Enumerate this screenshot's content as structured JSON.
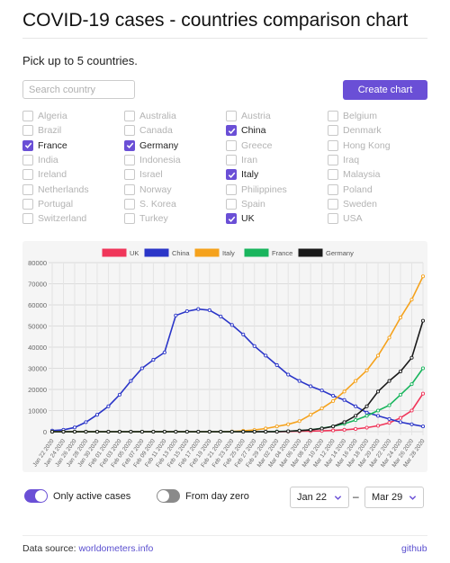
{
  "page": {
    "title": "COVID-19 cases - countries comparison chart",
    "subtitle": "Pick up to 5 countries."
  },
  "search": {
    "placeholder": "Search country",
    "value": ""
  },
  "create_button": {
    "label": "Create chart"
  },
  "accent_color": "#6a4fd6",
  "countries": [
    [
      "Algeria",
      "Brazil",
      "France",
      "India",
      "Ireland",
      "Netherlands",
      "Portugal",
      "Switzerland"
    ],
    [
      "Australia",
      "Canada",
      "Germany",
      "Indonesia",
      "Israel",
      "Norway",
      "S. Korea",
      "Turkey"
    ],
    [
      "Austria",
      "China",
      "Greece",
      "Iran",
      "Italy",
      "Philippines",
      "Spain",
      "UK"
    ],
    [
      "Belgium",
      "Denmark",
      "Hong Kong",
      "Iraq",
      "Malaysia",
      "Poland",
      "Sweden",
      "USA"
    ]
  ],
  "selected_countries": [
    "France",
    "Germany",
    "China",
    "Italy",
    "UK"
  ],
  "check_icon": "check-icon",
  "toggles": {
    "active_cases": {
      "label": "Only active cases",
      "on": true
    },
    "day_zero": {
      "label": "From day zero",
      "on": false
    }
  },
  "date_range": {
    "from": "Jan 22",
    "to": "Mar 29",
    "separator": "–"
  },
  "footer": {
    "source_prefix": "Data source:",
    "source_link": "worldometers.info",
    "github_link": "github"
  },
  "chart_data": {
    "type": "line",
    "title": "",
    "xlabel": "",
    "ylabel": "",
    "ylim": [
      0,
      80000
    ],
    "yticks": [
      0,
      10000,
      20000,
      30000,
      40000,
      50000,
      60000,
      70000,
      80000
    ],
    "grid": true,
    "legend_position": "top",
    "x": [
      "Jan 22 2020",
      "Jan 24 2020",
      "Jan 26 2020",
      "Jan 28 2020",
      "Jan 30 2020",
      "Feb 01 2020",
      "Feb 03 2020",
      "Feb 05 2020",
      "Feb 07 2020",
      "Feb 09 2020",
      "Feb 11 2020",
      "Feb 13 2020",
      "Feb 15 2020",
      "Feb 17 2020",
      "Feb 19 2020",
      "Feb 21 2020",
      "Feb 23 2020",
      "Feb 25 2020",
      "Feb 27 2020",
      "Feb 29 2020",
      "Mar 02 2020",
      "Mar 04 2020",
      "Mar 06 2020",
      "Mar 08 2020",
      "Mar 10 2020",
      "Mar 12 2020",
      "Mar 14 2020",
      "Mar 16 2020",
      "Mar 18 2020",
      "Mar 20 2020",
      "Mar 22 2020",
      "Mar 24 2020",
      "Mar 26 2020",
      "Mar 28 2020"
    ],
    "series": [
      {
        "name": "UK",
        "color": "#f0365a",
        "values": [
          0,
          0,
          0,
          0,
          0,
          0,
          0,
          0,
          0,
          0,
          0,
          0,
          0,
          0,
          0,
          0,
          0,
          0,
          0,
          0,
          50,
          100,
          200,
          300,
          400,
          600,
          900,
          1300,
          1900,
          2800,
          4200,
          6500,
          10000,
          18000
        ]
      },
      {
        "name": "China",
        "color": "#2a35c8",
        "values": [
          500,
          900,
          2000,
          4500,
          8000,
          12000,
          17500,
          24000,
          30000,
          34000,
          37500,
          55000,
          57000,
          58000,
          57500,
          54500,
          50500,
          46000,
          40500,
          36000,
          31500,
          27000,
          24000,
          21500,
          19500,
          17000,
          15000,
          12000,
          9000,
          7500,
          6000,
          4500,
          3500,
          2500
        ]
      },
      {
        "name": "Italy",
        "color": "#f5a21c",
        "values": [
          0,
          0,
          0,
          0,
          0,
          0,
          0,
          0,
          0,
          0,
          0,
          0,
          0,
          0,
          0,
          0,
          100,
          400,
          800,
          1500,
          2500,
          3500,
          5000,
          8000,
          11000,
          14500,
          19000,
          24000,
          29000,
          36000,
          44500,
          54000,
          62500,
          73500
        ]
      },
      {
        "name": "France",
        "color": "#19b55d",
        "values": [
          0,
          0,
          0,
          0,
          0,
          0,
          0,
          0,
          0,
          0,
          0,
          0,
          0,
          0,
          0,
          0,
          0,
          0,
          0,
          0,
          100,
          200,
          500,
          900,
          1600,
          2500,
          3800,
          5500,
          7500,
          10000,
          12500,
          17500,
          22500,
          30000
        ]
      },
      {
        "name": "Germany",
        "color": "#1a1a1a",
        "values": [
          0,
          0,
          0,
          0,
          0,
          0,
          0,
          0,
          0,
          0,
          0,
          0,
          0,
          0,
          0,
          0,
          0,
          0,
          0,
          0,
          0,
          200,
          500,
          900,
          1500,
          2500,
          4500,
          7500,
          12000,
          19000,
          24000,
          28500,
          35000,
          52500
        ]
      }
    ]
  }
}
